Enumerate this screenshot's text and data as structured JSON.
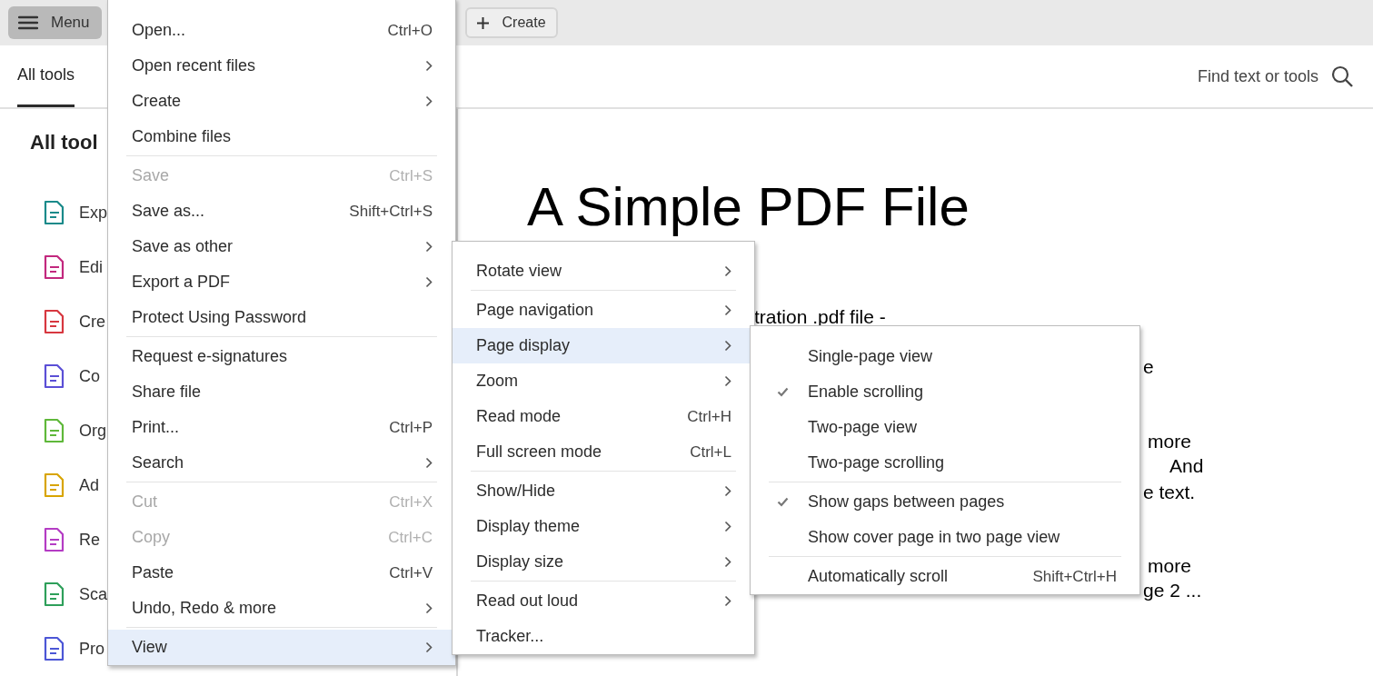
{
  "top_bar": {
    "menu_button": "Menu",
    "create_button": "Create"
  },
  "tabs": [
    {
      "label": "All tools",
      "selected": true
    }
  ],
  "search": {
    "placeholder": "Find text or tools"
  },
  "sidebar": {
    "title": "All tool",
    "items": [
      {
        "label": "Exp",
        "color": "#1a8a8a"
      },
      {
        "label": "Edi",
        "color": "#c2287e"
      },
      {
        "label": "Cre",
        "color": "#d7373f"
      },
      {
        "label": "Co",
        "color": "#5b4fd6"
      },
      {
        "label": "Org",
        "color": "#5fb83a"
      },
      {
        "label": "Ad",
        "color": "#d8a400"
      },
      {
        "label": "Re",
        "color": "#b43cc4"
      },
      {
        "label": "Sca",
        "color": "#2e9f5a"
      },
      {
        "label": "Pro",
        "color": "#4c56d6"
      }
    ]
  },
  "document": {
    "title": "A Simple PDF File",
    "fragments": [
      "tration .pdf file -",
      "e",
      "more",
      "And",
      "e text.",
      "more",
      "ge 2 ..."
    ]
  },
  "menus": [
    {
      "items": [
        {
          "kind": "item",
          "label": "Open...",
          "shortcut": "Ctrl+O",
          "submenu": false,
          "disabled": false,
          "selected": false
        },
        {
          "kind": "item",
          "label": "Open recent files",
          "submenu": true,
          "disabled": false,
          "selected": false
        },
        {
          "kind": "item",
          "label": "Create",
          "submenu": true,
          "disabled": false,
          "selected": false
        },
        {
          "kind": "item",
          "label": "Combine files",
          "submenu": false,
          "disabled": false,
          "selected": false
        },
        {
          "kind": "separator"
        },
        {
          "kind": "item",
          "label": "Save",
          "shortcut": "Ctrl+S",
          "submenu": false,
          "disabled": true,
          "selected": false
        },
        {
          "kind": "item",
          "label": "Save as...",
          "shortcut": "Shift+Ctrl+S",
          "submenu": false,
          "disabled": false,
          "selected": false
        },
        {
          "kind": "item",
          "label": "Save as other",
          "submenu": true,
          "disabled": false,
          "selected": false
        },
        {
          "kind": "item",
          "label": "Export a PDF",
          "submenu": true,
          "disabled": false,
          "selected": false
        },
        {
          "kind": "item",
          "label": "Protect Using Password",
          "submenu": false,
          "disabled": false,
          "selected": false
        },
        {
          "kind": "separator"
        },
        {
          "kind": "item",
          "label": "Request e-signatures",
          "submenu": false,
          "disabled": false,
          "selected": false
        },
        {
          "kind": "item",
          "label": "Share file",
          "submenu": false,
          "disabled": false,
          "selected": false
        },
        {
          "kind": "item",
          "label": "Print...",
          "shortcut": "Ctrl+P",
          "submenu": false,
          "disabled": false,
          "selected": false
        },
        {
          "kind": "item",
          "label": "Search",
          "submenu": true,
          "disabled": false,
          "selected": false
        },
        {
          "kind": "separator"
        },
        {
          "kind": "item",
          "label": "Cut",
          "shortcut": "Ctrl+X",
          "submenu": false,
          "disabled": true,
          "selected": false
        },
        {
          "kind": "item",
          "label": "Copy",
          "shortcut": "Ctrl+C",
          "submenu": false,
          "disabled": true,
          "selected": false
        },
        {
          "kind": "item",
          "label": "Paste",
          "shortcut": "Ctrl+V",
          "submenu": false,
          "disabled": false,
          "selected": false
        },
        {
          "kind": "item",
          "label": "Undo, Redo & more",
          "submenu": true,
          "disabled": false,
          "selected": false
        },
        {
          "kind": "separator"
        },
        {
          "kind": "item",
          "label": "View",
          "submenu": true,
          "disabled": false,
          "selected": true
        }
      ]
    },
    {
      "items": [
        {
          "kind": "item",
          "label": "Rotate view",
          "submenu": true,
          "disabled": false,
          "selected": false
        },
        {
          "kind": "separator"
        },
        {
          "kind": "item",
          "label": "Page navigation",
          "submenu": true,
          "disabled": false,
          "selected": false
        },
        {
          "kind": "item",
          "label": "Page display",
          "submenu": true,
          "disabled": false,
          "selected": true
        },
        {
          "kind": "item",
          "label": "Zoom",
          "submenu": true,
          "disabled": false,
          "selected": false
        },
        {
          "kind": "item",
          "label": "Read mode",
          "shortcut": "Ctrl+H",
          "submenu": false,
          "disabled": false,
          "selected": false
        },
        {
          "kind": "item",
          "label": "Full screen mode",
          "shortcut": "Ctrl+L",
          "submenu": false,
          "disabled": false,
          "selected": false
        },
        {
          "kind": "separator"
        },
        {
          "kind": "item",
          "label": "Show/Hide",
          "submenu": true,
          "disabled": false,
          "selected": false
        },
        {
          "kind": "item",
          "label": "Display theme",
          "submenu": true,
          "disabled": false,
          "selected": false
        },
        {
          "kind": "item",
          "label": "Display size",
          "submenu": true,
          "disabled": false,
          "selected": false
        },
        {
          "kind": "separator"
        },
        {
          "kind": "item",
          "label": "Read out loud",
          "submenu": true,
          "disabled": false,
          "selected": false
        },
        {
          "kind": "item",
          "label": "Tracker...",
          "submenu": false,
          "disabled": false,
          "selected": false
        }
      ]
    },
    {
      "items": [
        {
          "kind": "item",
          "label": "Single-page view",
          "checked": false,
          "submenu": false,
          "disabled": false,
          "selected": false
        },
        {
          "kind": "item",
          "label": "Enable scrolling",
          "checked": true,
          "submenu": false,
          "disabled": false,
          "selected": false
        },
        {
          "kind": "item",
          "label": "Two-page view",
          "checked": false,
          "submenu": false,
          "disabled": false,
          "selected": false
        },
        {
          "kind": "item",
          "label": "Two-page scrolling",
          "checked": false,
          "submenu": false,
          "disabled": false,
          "selected": false
        },
        {
          "kind": "separator"
        },
        {
          "kind": "item",
          "label": "Show gaps between pages",
          "checked": true,
          "submenu": false,
          "disabled": false,
          "selected": false
        },
        {
          "kind": "item",
          "label": "Show cover page in two page view",
          "checked": false,
          "submenu": false,
          "disabled": false,
          "selected": false
        },
        {
          "kind": "separator"
        },
        {
          "kind": "item",
          "label": "Automatically scroll",
          "shortcut": "Shift+Ctrl+H",
          "checked": false,
          "submenu": false,
          "disabled": false,
          "selected": false
        }
      ]
    }
  ]
}
